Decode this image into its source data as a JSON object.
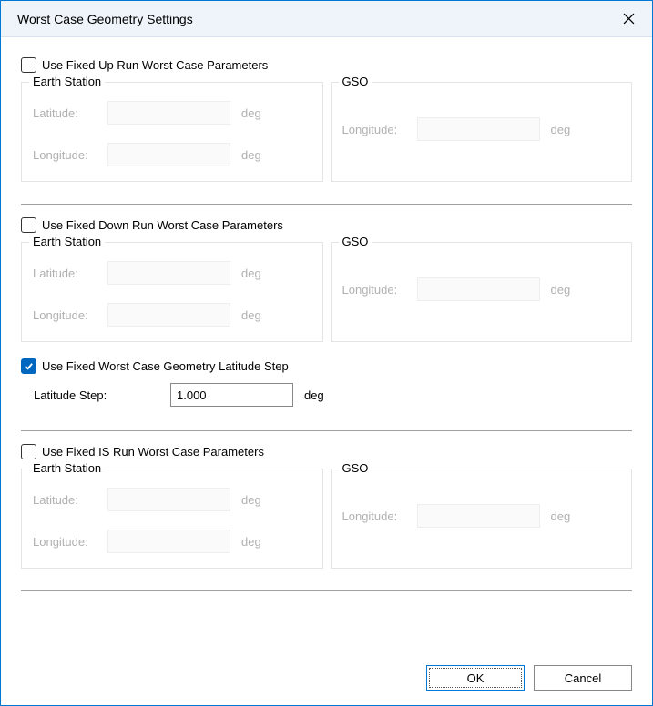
{
  "title": "Worst Case Geometry Settings",
  "sections": {
    "up": {
      "checkbox_label": "Use Fixed Up Run Worst Case Parameters",
      "checked": false,
      "earth_station": {
        "legend": "Earth Station",
        "latitude_label": "Latitude:",
        "latitude_value": "",
        "latitude_unit": "deg",
        "longitude_label": "Longitude:",
        "longitude_value": "",
        "longitude_unit": "deg"
      },
      "gso": {
        "legend": "GSO",
        "longitude_label": "Longitude:",
        "longitude_value": "",
        "longitude_unit": "deg"
      }
    },
    "down": {
      "checkbox_label": "Use Fixed Down Run Worst Case Parameters",
      "checked": false,
      "earth_station": {
        "legend": "Earth Station",
        "latitude_label": "Latitude:",
        "latitude_value": "",
        "latitude_unit": "deg",
        "longitude_label": "Longitude:",
        "longitude_value": "",
        "longitude_unit": "deg"
      },
      "gso": {
        "legend": "GSO",
        "longitude_label": "Longitude:",
        "longitude_value": "",
        "longitude_unit": "deg"
      }
    },
    "latstep": {
      "checkbox_label": "Use Fixed Worst Case Geometry Latitude Step",
      "checked": true,
      "label": "Latitude Step:",
      "value": "1.000",
      "unit": "deg"
    },
    "is": {
      "checkbox_label": "Use Fixed IS Run Worst Case Parameters",
      "checked": false,
      "earth_station": {
        "legend": "Earth Station",
        "latitude_label": "Latitude:",
        "latitude_value": "",
        "latitude_unit": "deg",
        "longitude_label": "Longitude:",
        "longitude_value": "",
        "longitude_unit": "deg"
      },
      "gso": {
        "legend": "GSO",
        "longitude_label": "Longitude:",
        "longitude_value": "",
        "longitude_unit": "deg"
      }
    }
  },
  "buttons": {
    "ok": "OK",
    "cancel": "Cancel"
  }
}
